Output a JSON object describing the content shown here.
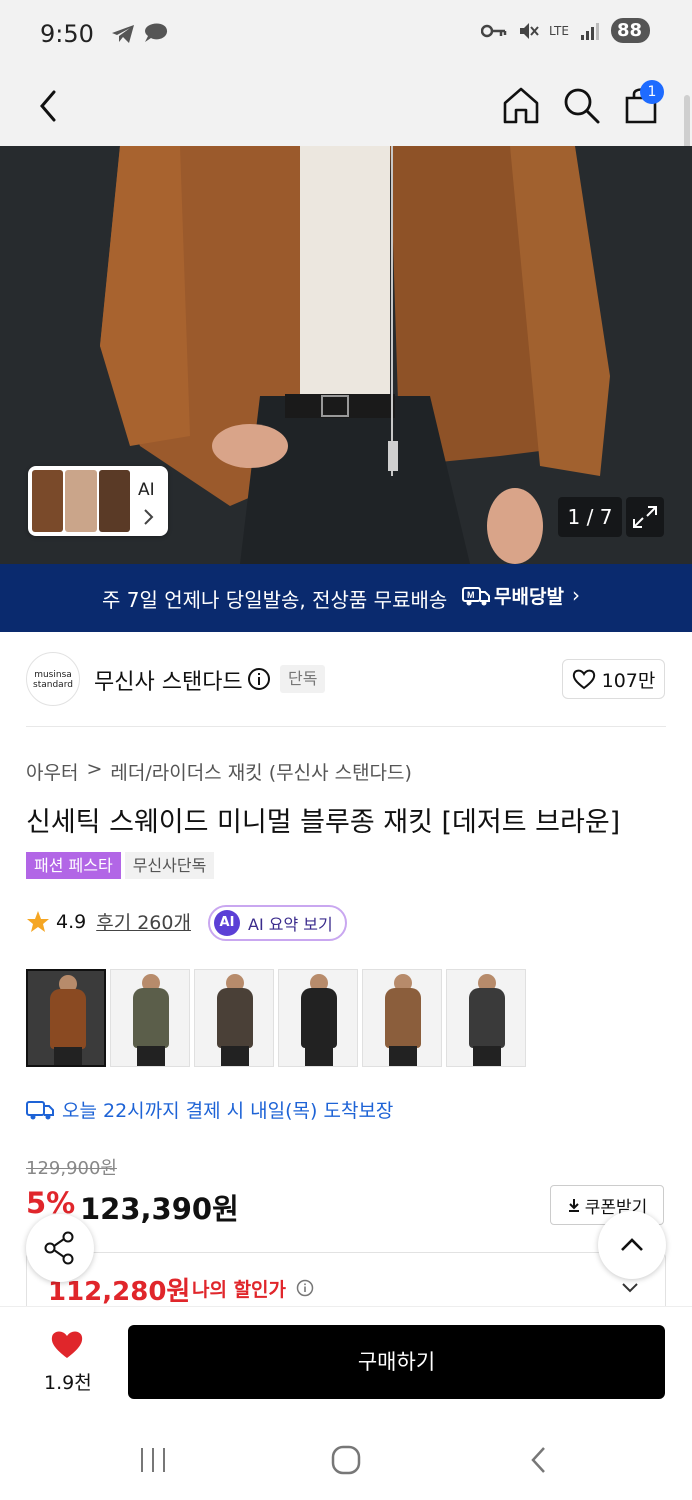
{
  "status_bar": {
    "time": "9:50",
    "network": "LTE",
    "battery": "88"
  },
  "header": {
    "cart_count": "1"
  },
  "hero": {
    "ai_chip_label": "AI",
    "image_counter": "1 / 7"
  },
  "banner": {
    "text": "주 7일 언제나 당일발송, 전상품 무료배송",
    "logo_text": "무배당발",
    "chevron": "›"
  },
  "brand": {
    "logo_line1": "musinsa",
    "logo_line2": "standard",
    "name": "무신사 스탠다드",
    "exclusive_badge": "단독",
    "like_count": "107만"
  },
  "product": {
    "breadcrumb": [
      "아우터",
      "레더/라이더스 재킷 (무신사 스탠다드)"
    ],
    "breadcrumb_sep": ">",
    "title": "신세틱 스웨이드 미니멀 블루종 재킷 [데저트 브라운]",
    "tags": [
      "패션 페스타",
      "무신사단독"
    ],
    "rating": "4.9",
    "reviews": "후기 260개",
    "ai_summary_badge": "AI",
    "ai_summary_label": "AI 요약 보기",
    "swatch_colors": [
      "#8a4a22",
      "#5b5e4a",
      "#4a4037",
      "#222222",
      "#8b5e3c",
      "#3a3a3a"
    ],
    "delivery_text": "오늘 22시까지 결제 시 내일(목) 도착보장"
  },
  "pricing": {
    "original_price": "129,900원",
    "discount_rate": "5%",
    "sale_price": "123,390원",
    "coupon_button": "쿠폰받기",
    "my_price": "112,280원",
    "my_price_label": "나의 할인가"
  },
  "bottom_bar": {
    "likes": "1.9천",
    "buy_button": "구매하기"
  },
  "colors": {
    "banner_bg": "#0a2a6e",
    "accent_red": "#e0262b",
    "accent_blue": "#1e63d6",
    "tag_purple": "#b266e6"
  }
}
